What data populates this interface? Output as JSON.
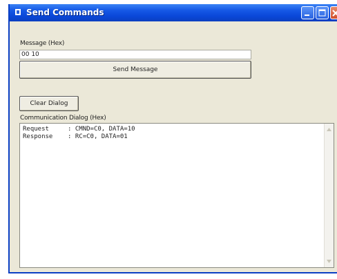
{
  "window": {
    "title": "Send Commands",
    "colors": {
      "titlebar": "#0a47d8",
      "client": "#ebe8d8",
      "close": "#d0502c"
    }
  },
  "message": {
    "label": "Message (Hex)",
    "value": "00 10",
    "send_label": "Send Message"
  },
  "actions": {
    "clear_label": "Clear Dialog"
  },
  "dialog": {
    "label": "Communication Dialog (Hex)",
    "lines": [
      "Request     : CMND=C0, DATA=10",
      "Response    : RC=C0, DATA=01"
    ]
  },
  "icons": [
    "app-icon",
    "minimize-icon",
    "maximize-icon",
    "close-icon",
    "scroll-up-icon",
    "scroll-down-icon"
  ]
}
